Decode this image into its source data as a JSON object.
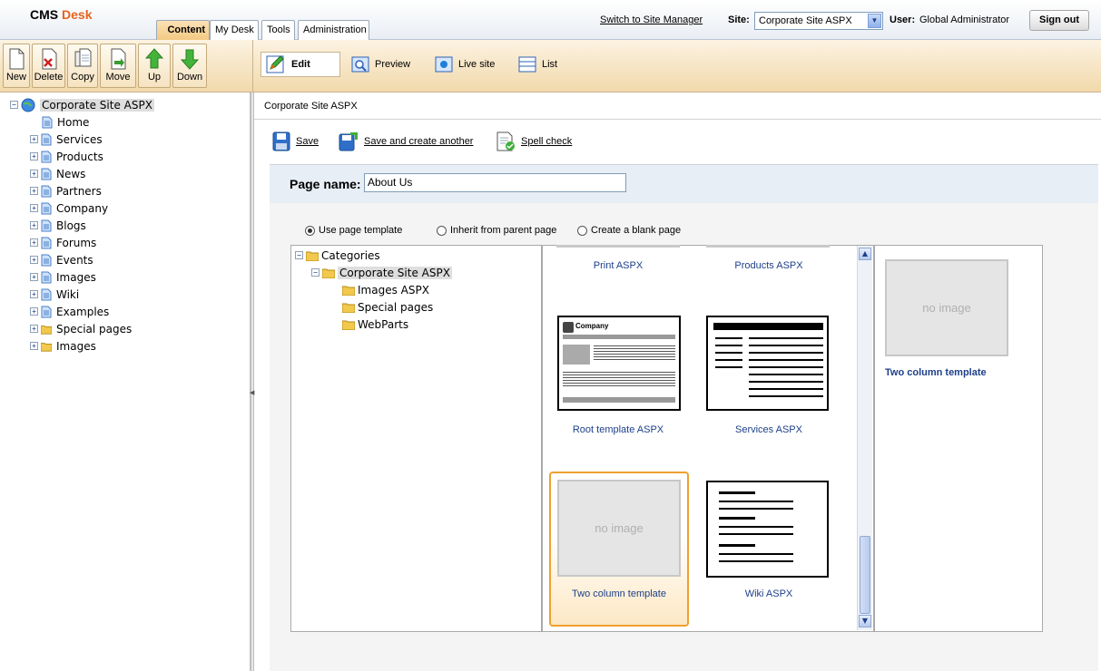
{
  "header": {
    "brand_cms": "CMS",
    "brand_desk": "Desk",
    "tabs": [
      "Content",
      "My Desk",
      "Tools",
      "Administration"
    ],
    "switch_link": "Switch to Site Manager",
    "site_label": "Site:",
    "site_value": "Corporate Site ASPX",
    "user_label": "User:",
    "user_value": "Global Administrator",
    "signout": "Sign out"
  },
  "toolbar": {
    "buttons": [
      "New",
      "Delete",
      "Copy",
      "Move",
      "Up",
      "Down"
    ],
    "views": [
      "Edit",
      "Preview",
      "Live site",
      "List"
    ]
  },
  "tree": {
    "root": "Corporate Site ASPX",
    "items": [
      "Home",
      "Services",
      "Products",
      "News",
      "Partners",
      "Company",
      "Blogs",
      "Forums",
      "Events",
      "Images",
      "Wiki",
      "Examples",
      "Special pages",
      "Images"
    ]
  },
  "breadcrumb": "Corporate Site ASPX",
  "actions": {
    "save": "Save",
    "save_another": "Save and create another",
    "spell": "Spell check"
  },
  "form": {
    "page_name_label": "Page name:",
    "page_name_value": "About Us",
    "radios": [
      "Use page template",
      "Inherit from parent page",
      "Create a blank page"
    ],
    "selected_radio": 0
  },
  "categories": {
    "root": "Categories",
    "site": "Corporate Site ASPX",
    "children": [
      "Images ASPX",
      "Special pages",
      "WebParts"
    ]
  },
  "templates": {
    "top_labels": [
      "Print ASPX",
      "Products ASPX"
    ],
    "row1": [
      "Root template ASPX",
      "Services ASPX"
    ],
    "row2": [
      "Two column template",
      "Wiki ASPX"
    ],
    "no_image": "no image",
    "company_thumb_title": "Company",
    "selected": "Two column template"
  },
  "preview": {
    "no_image": "no image",
    "title": "Two column template"
  },
  "colors": {
    "brand_orange": "#e8631b",
    "link_blue": "#1d3f8a",
    "selection_orange": "#f0a030"
  }
}
